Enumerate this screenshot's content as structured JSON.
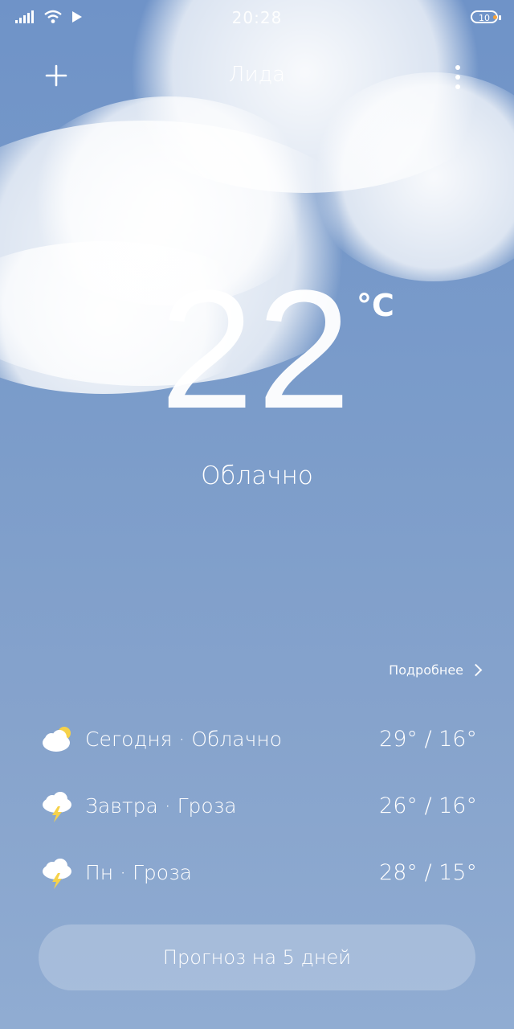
{
  "status": {
    "time": "20:28",
    "battery": "10"
  },
  "header": {
    "city": "Лида",
    "add_icon": "plus-icon",
    "menu_icon": "more-vertical-icon"
  },
  "current": {
    "temperature": "22",
    "unit": "°C",
    "condition": "Облачно"
  },
  "details_link": "Подробнее",
  "forecast": [
    {
      "label": "Сегодня · Облачно",
      "temps": "29° / 16°",
      "icon": "partly-cloudy-icon"
    },
    {
      "label": "Завтра · Гроза",
      "temps": "26° / 16°",
      "icon": "thunderstorm-icon"
    },
    {
      "label": "Пн · Гроза",
      "temps": "28° / 15°",
      "icon": "thunderstorm-icon"
    }
  ],
  "cta_label": "Прогноз на 5 дней"
}
